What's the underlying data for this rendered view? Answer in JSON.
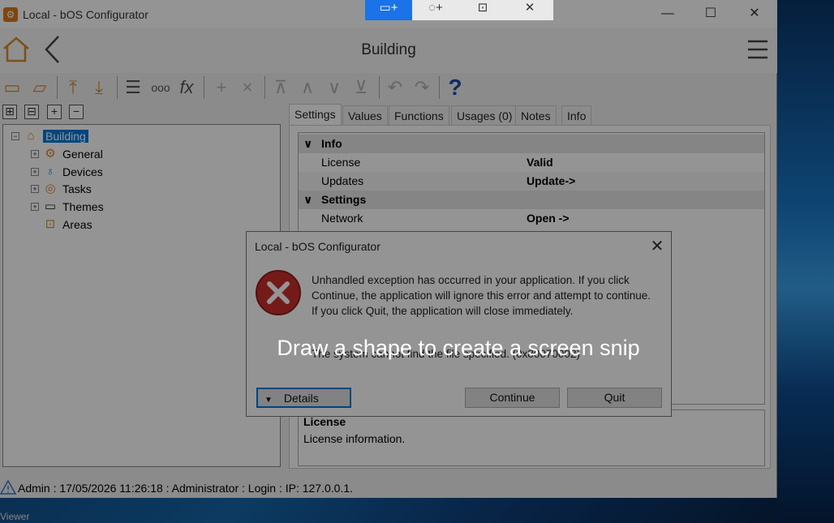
{
  "desktop": {
    "taskbar_label": "Viewer"
  },
  "snip_toolbar": {
    "buttons": [
      "▭+",
      "◌+",
      "⊡",
      "✕"
    ]
  },
  "window": {
    "title": "Local - bOS Configurator",
    "controls": {
      "minimize": "—",
      "maximize": "☐",
      "close": "✕"
    }
  },
  "nav": {
    "title": "Building"
  },
  "toolbar": {
    "icons": [
      "save-icon",
      "open-folder-icon",
      "upload-icon",
      "download-icon",
      "settings-sliders-icon",
      "dots-icon",
      "fx-icon",
      "add-icon",
      "remove-icon",
      "move-top-icon",
      "move-up-icon",
      "move-down-icon",
      "move-bottom-icon",
      "undo-icon",
      "redo-icon",
      "help-icon"
    ],
    "fx_label": "fx",
    "dots_label": "ooo",
    "help_label": "?"
  },
  "tree": {
    "root": "Building",
    "items": [
      {
        "label": "General",
        "icon": "gear-icon"
      },
      {
        "label": "Devices",
        "icon": "bulb-icon"
      },
      {
        "label": "Tasks",
        "icon": "tasks-icon"
      },
      {
        "label": "Themes",
        "icon": "monitor-icon"
      },
      {
        "label": "Areas",
        "icon": "areas-icon"
      }
    ]
  },
  "tabs": [
    "Settings",
    "Values",
    "Functions",
    "Usages (0)",
    "Notes",
    "Info"
  ],
  "grid": {
    "info_header": "Info",
    "license_label": "License",
    "license_value": "Valid",
    "updates_label": "Updates",
    "updates_value": "Update->",
    "settings_header": "Settings",
    "network_label": "Network",
    "network_value": "Open ->"
  },
  "description": {
    "title": "License",
    "text": "License information."
  },
  "status": "Admin : 17/05/2026 11:26:18 : Administrator : Login : IP: 127.0.0.1.",
  "dialog": {
    "title": "Local - bOS Configurator",
    "message": "Unhandled exception has occurred in your application. If you click Continue, the application will ignore this error and attempt to continue. If you click Quit, the application will close immediately.",
    "detail": "The system cannot find the file specified. (0x80070002)",
    "details_button": "Details",
    "continue_button": "Continue",
    "quit_button": "Quit"
  },
  "snip_overlay": {
    "text": "Draw a shape to create a screen snip"
  }
}
